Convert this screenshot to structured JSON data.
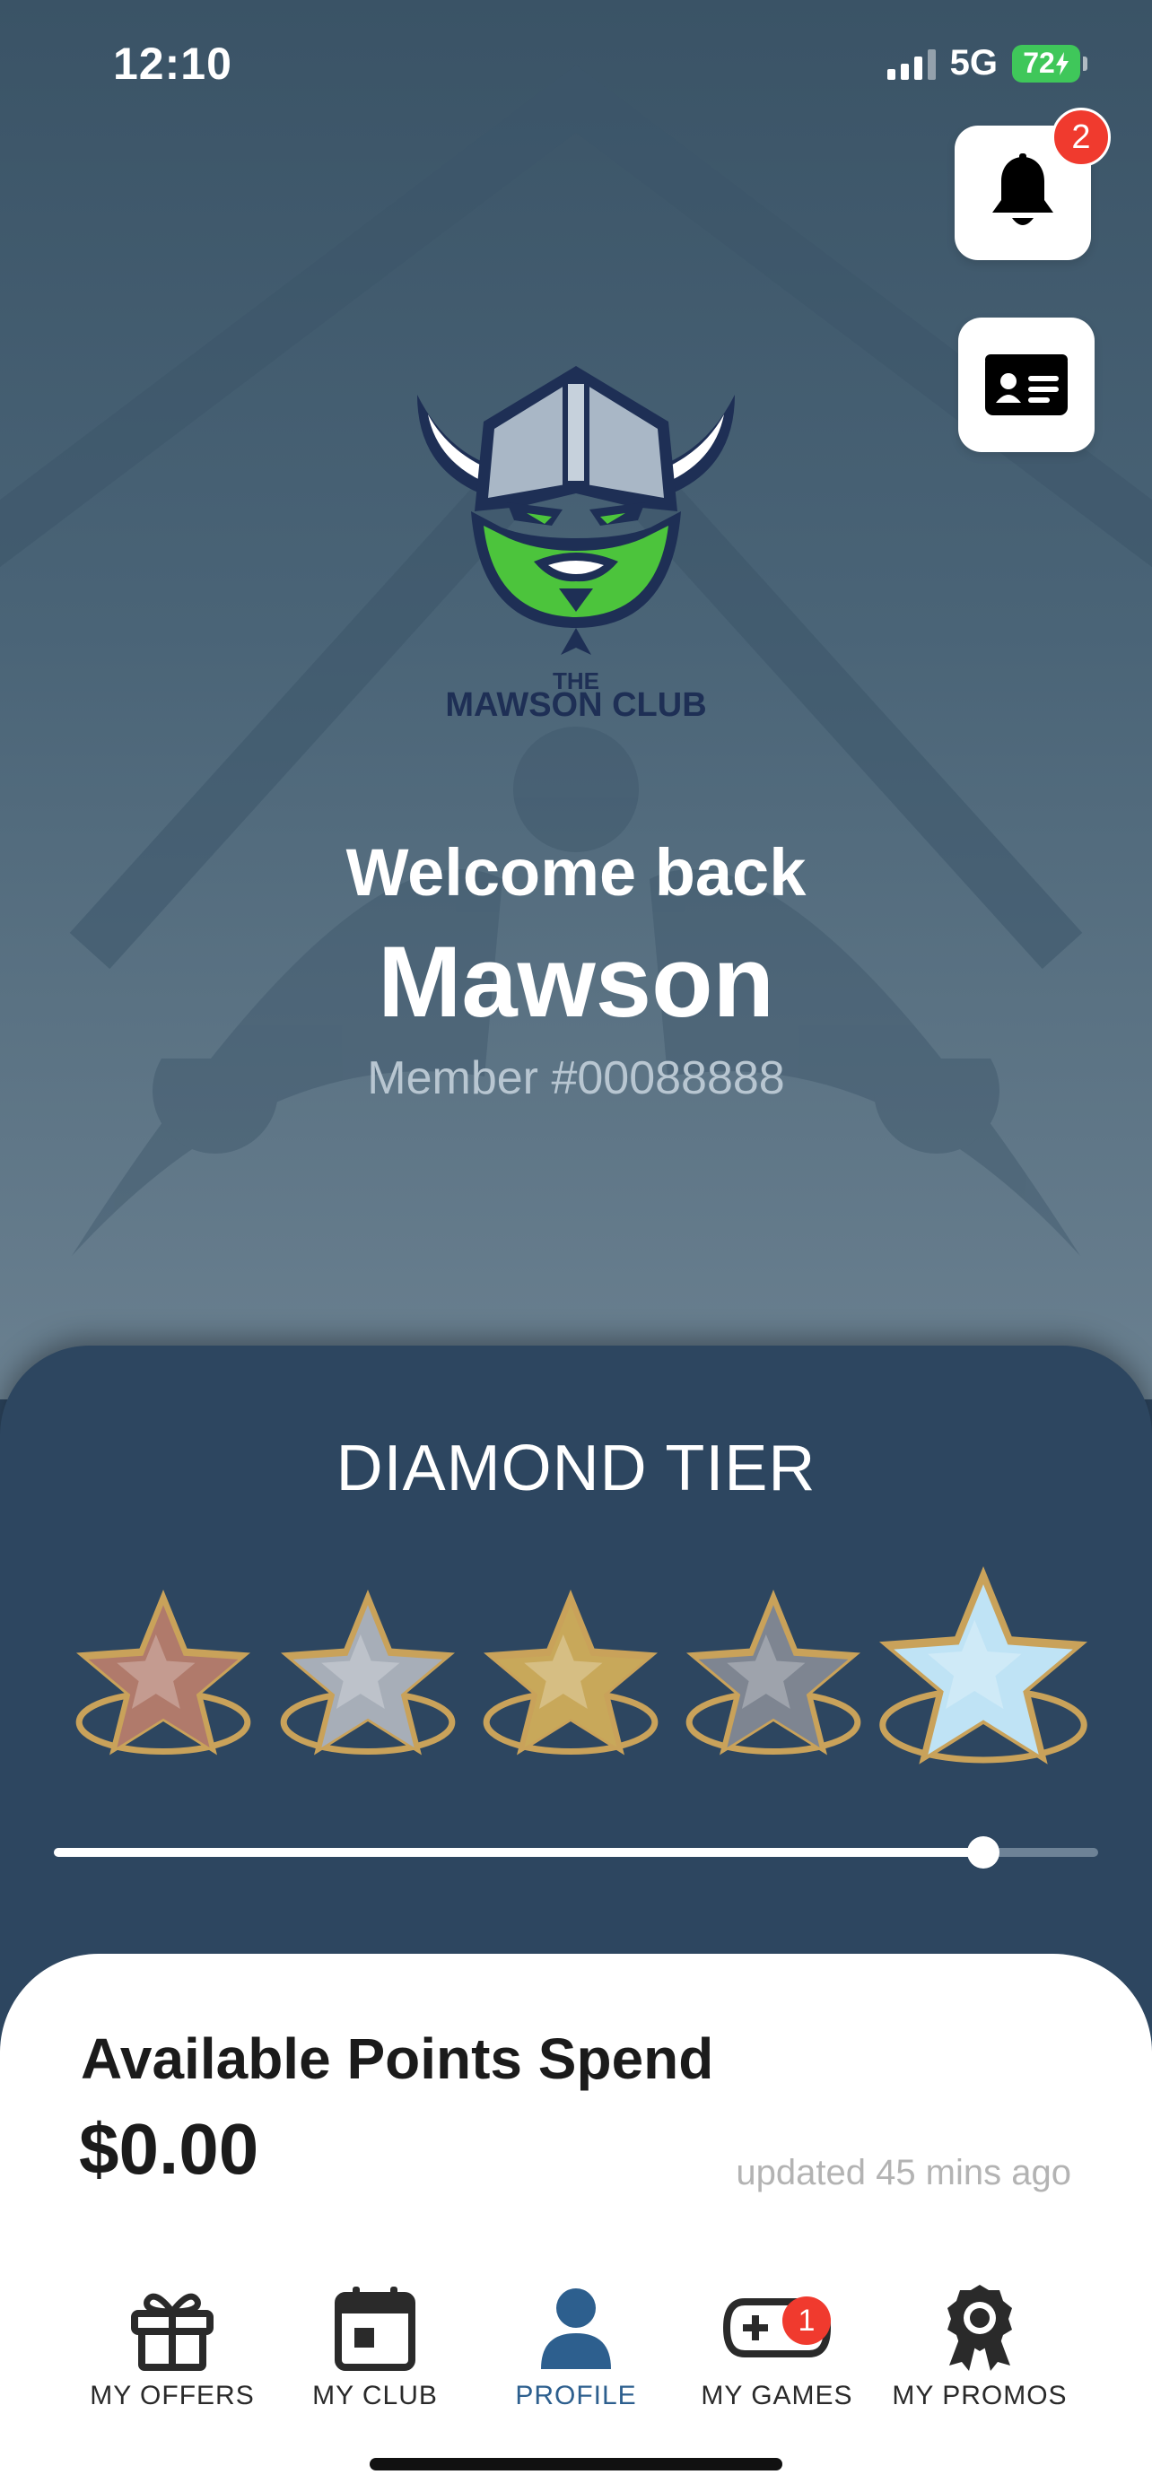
{
  "status_bar": {
    "time": "12:10",
    "network": "5G",
    "battery": "72",
    "icons": [
      "signal-icon",
      "battery-charging-icon"
    ]
  },
  "header": {
    "notifications": {
      "icon": "bell-icon",
      "badge": "2"
    },
    "member_card": {
      "icon": "id-card-icon"
    }
  },
  "logo": {
    "line1": "THE",
    "line2": "MAWSON CLUB",
    "icon": "viking-mascot-logo",
    "colors": {
      "navy": "#1e2f55",
      "green": "#4cc43c",
      "silver": "#a9b7c6",
      "white": "#ffffff"
    }
  },
  "welcome": {
    "greeting": "Welcome back",
    "name": "Mawson",
    "member_number": "Member #00088888"
  },
  "tier": {
    "title": "DIAMOND TIER",
    "stars": [
      {
        "name": "bronze",
        "color": "#b07a6b"
      },
      {
        "name": "silver",
        "color": "#a7aeb8"
      },
      {
        "name": "gold",
        "color": "#c8a85a"
      },
      {
        "name": "platinum",
        "color": "#7e8591"
      },
      {
        "name": "diamond",
        "color": "#bfe3f5"
      }
    ],
    "progress": 0.89
  },
  "points": {
    "label": "Available Points Spend",
    "value": "$0.00",
    "updated": "updated 45 mins ago"
  },
  "tabs": [
    {
      "label": "MY OFFERS",
      "icon": "gift-icon",
      "active": false,
      "badge": ""
    },
    {
      "label": "MY CLUB",
      "icon": "calendar-icon",
      "active": false,
      "badge": ""
    },
    {
      "label": "PROFILE",
      "icon": "profile-icon",
      "active": true,
      "badge": ""
    },
    {
      "label": "MY GAMES",
      "icon": "gamepad-icon",
      "active": false,
      "badge": "1"
    },
    {
      "label": "MY PROMOS",
      "icon": "award-ribbon-icon",
      "active": false,
      "badge": ""
    }
  ],
  "colors": {
    "panel": "#2d4660",
    "accent": "#2d5f8e",
    "badge": "#f03a2e",
    "battery": "#3fc75a"
  }
}
